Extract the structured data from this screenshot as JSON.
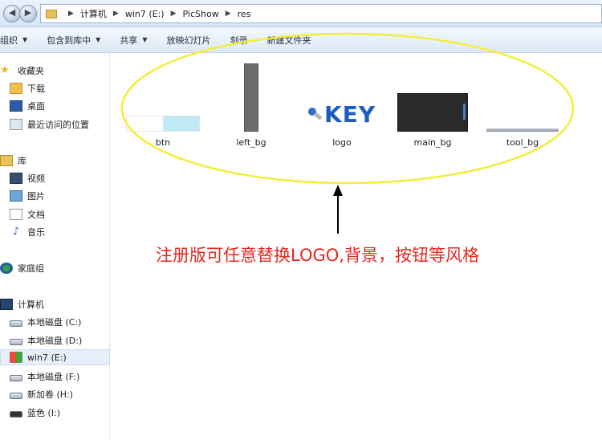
{
  "breadcrumbs": [
    "计算机",
    "win7 (E:)",
    "PicShow",
    "res"
  ],
  "toolbar": {
    "organize": "组织",
    "include_in_library": "包含到库中",
    "share": "共享",
    "slideshow": "放映幻灯片",
    "burn": "刻录",
    "new_folder": "新建文件夹"
  },
  "nav": {
    "favorites": "收藏夹",
    "downloads": "下载",
    "desktop": "桌面",
    "recent": "最近访问的位置",
    "libraries": "库",
    "videos": "视频",
    "pictures": "图片",
    "documents": "文档",
    "music": "音乐",
    "homegroup": "家庭组",
    "computer": "计算机",
    "drive_c": "本地磁盘 (C:)",
    "drive_d": "本地磁盘 (D:)",
    "drive_e": "win7 (E:)",
    "drive_f": "本地磁盘 (F:)",
    "drive_h": "新加卷 (H:)",
    "drive_i": "蓝色 (I:)"
  },
  "files": {
    "btn": "btn",
    "left_bg": "left_bg",
    "logo": "logo",
    "logo_text": "KEY",
    "main_bg": "main_bg",
    "tool_bg": "tool_bg"
  },
  "annotation": {
    "text": "注册版可任意替换LOGO,背景，按钮等风格",
    "color": "#e8261e",
    "highlight_color": "#f2ee3a"
  }
}
